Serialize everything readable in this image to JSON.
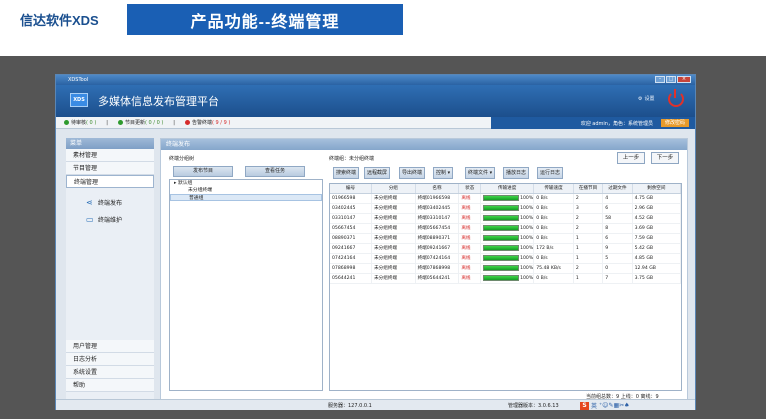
{
  "slide": {
    "brand": "信达软件XDS",
    "title": "产品功能--终端管理"
  },
  "window": {
    "title": "XDSTool"
  },
  "header": {
    "logo": "XDS",
    "title": "多媒体信息发布管理平台",
    "settings": "设置"
  },
  "status": {
    "items": [
      {
        "label": "待审核",
        "value": "( 0 )",
        "color": "#2e9a2e"
      },
      {
        "label": "节目更新",
        "value": "( 0 / 0 )",
        "color": "#2e9a2e"
      },
      {
        "label": "告警终端",
        "value": "( 9 / 9 )",
        "color": "#d62b2b"
      }
    ],
    "welcome": "欢迎 admin，角色：系统管理员",
    "logout": "修改密码"
  },
  "sidebar": {
    "head": "菜单",
    "top": [
      "素材管理",
      "节目管理",
      "终端管理"
    ],
    "sub": [
      "终端发布",
      "终端维护"
    ],
    "bottom": [
      "用户管理",
      "日志分析",
      "系统设置",
      "帮助"
    ]
  },
  "content": {
    "head": "终端发布",
    "prev": "上一步",
    "next": "下一步",
    "group_label": "终端分组树",
    "publish_btn": "发布节目",
    "view_task_btn": "查看任务",
    "tree": [
      "默认组",
      "未分组终端",
      "普通组"
    ],
    "current_group": "终端组：未分组终端",
    "toolbar": [
      "搜索终端",
      "远程截屏",
      "导出终端",
      "控制",
      "终端文件",
      "播放日志",
      "运行日志"
    ],
    "summary": "当前组总数：9  上线：0  离线：9"
  },
  "table": {
    "headers": [
      "编号",
      "分组",
      "名称",
      "状态",
      "传输进度",
      "传输速度",
      "在播节目",
      "过期文件",
      "剩余空间"
    ],
    "rows": [
      {
        "id": "01966598",
        "group": "未分组终端",
        "name": "终端01966598",
        "status": "离线",
        "progress": 100,
        "pct": "100%",
        "speed": "0 B/s",
        "playing": "2",
        "expired": "4",
        "space": "4.75 GB"
      },
      {
        "id": "03402445",
        "group": "未分组终端",
        "name": "终端03402445",
        "status": "离线",
        "progress": 100,
        "pct": "100%",
        "speed": "0 B/s",
        "playing": "3",
        "expired": "6",
        "space": "2.96 GB"
      },
      {
        "id": "03310147",
        "group": "未分组终端",
        "name": "终端03310147",
        "status": "离线",
        "progress": 100,
        "pct": "100%",
        "speed": "0 B/s",
        "playing": "2",
        "expired": "58",
        "space": "4.52 GB"
      },
      {
        "id": "05667454",
        "group": "未分组终端",
        "name": "终端05667454",
        "status": "离线",
        "progress": 100,
        "pct": "100%",
        "speed": "0 B/s",
        "playing": "2",
        "expired": "8",
        "space": "3.69 GB"
      },
      {
        "id": "08890371",
        "group": "未分组终端",
        "name": "终端08890371",
        "status": "离线",
        "progress": 100,
        "pct": "100%",
        "speed": "0 B/s",
        "playing": "1",
        "expired": "6",
        "space": "7.59 GB"
      },
      {
        "id": "09241667",
        "group": "未分组终端",
        "name": "终端09241667",
        "status": "离线",
        "progress": 100,
        "pct": "100%",
        "speed": "172 B/s",
        "playing": "1",
        "expired": "9",
        "space": "5.42 GB"
      },
      {
        "id": "07424164",
        "group": "未分组终端",
        "name": "终端07424164",
        "status": "离线",
        "progress": 100,
        "pct": "100%",
        "speed": "0 B/s",
        "playing": "1",
        "expired": "5",
        "space": "4.85 GB"
      },
      {
        "id": "07868998",
        "group": "未分组终端",
        "name": "终端07868998",
        "status": "离线",
        "progress": 100,
        "pct": "100%",
        "speed": "75.48 KB/s",
        "playing": "2",
        "expired": "0",
        "space": "12.94 GB"
      },
      {
        "id": "05644241",
        "group": "未分组终端",
        "name": "终端05644241",
        "status": "离线",
        "progress": 100,
        "pct": "100%",
        "speed": "0 B/s",
        "playing": "1",
        "expired": "7",
        "space": "3.75 GB"
      }
    ]
  },
  "footer": {
    "server": "服务器：127.0.0.1",
    "version": "管理器版本：3.0.6.13",
    "ime_label": "英"
  }
}
